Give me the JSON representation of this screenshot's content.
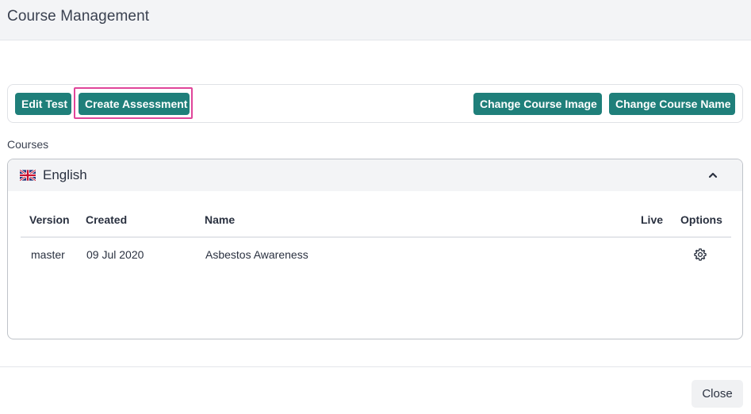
{
  "modal": {
    "title": "Course Management"
  },
  "toolbar": {
    "edit_test_label": "Edit Test",
    "create_assessment_label": "Create Assessment",
    "change_course_image_label": "Change Course Image",
    "change_course_name_label": "Change Course Name"
  },
  "courses": {
    "section_label": "Courses",
    "panel": {
      "language": "English",
      "flag_icon": "uk-flag-icon",
      "collapse_icon": "chevron-up-icon",
      "columns": [
        "Version",
        "Created",
        "Name",
        "Live",
        "Options"
      ],
      "rows": [
        {
          "version": "master",
          "created": "09 Jul 2020",
          "name": "Asbestos Awareness",
          "live": "",
          "options_icon": "gear-icon"
        }
      ]
    }
  },
  "footer": {
    "close_label": "Close"
  },
  "colors": {
    "primary": "#1f7f7a",
    "highlight": "#e0459a",
    "header_bg": "#f3f4f6"
  }
}
